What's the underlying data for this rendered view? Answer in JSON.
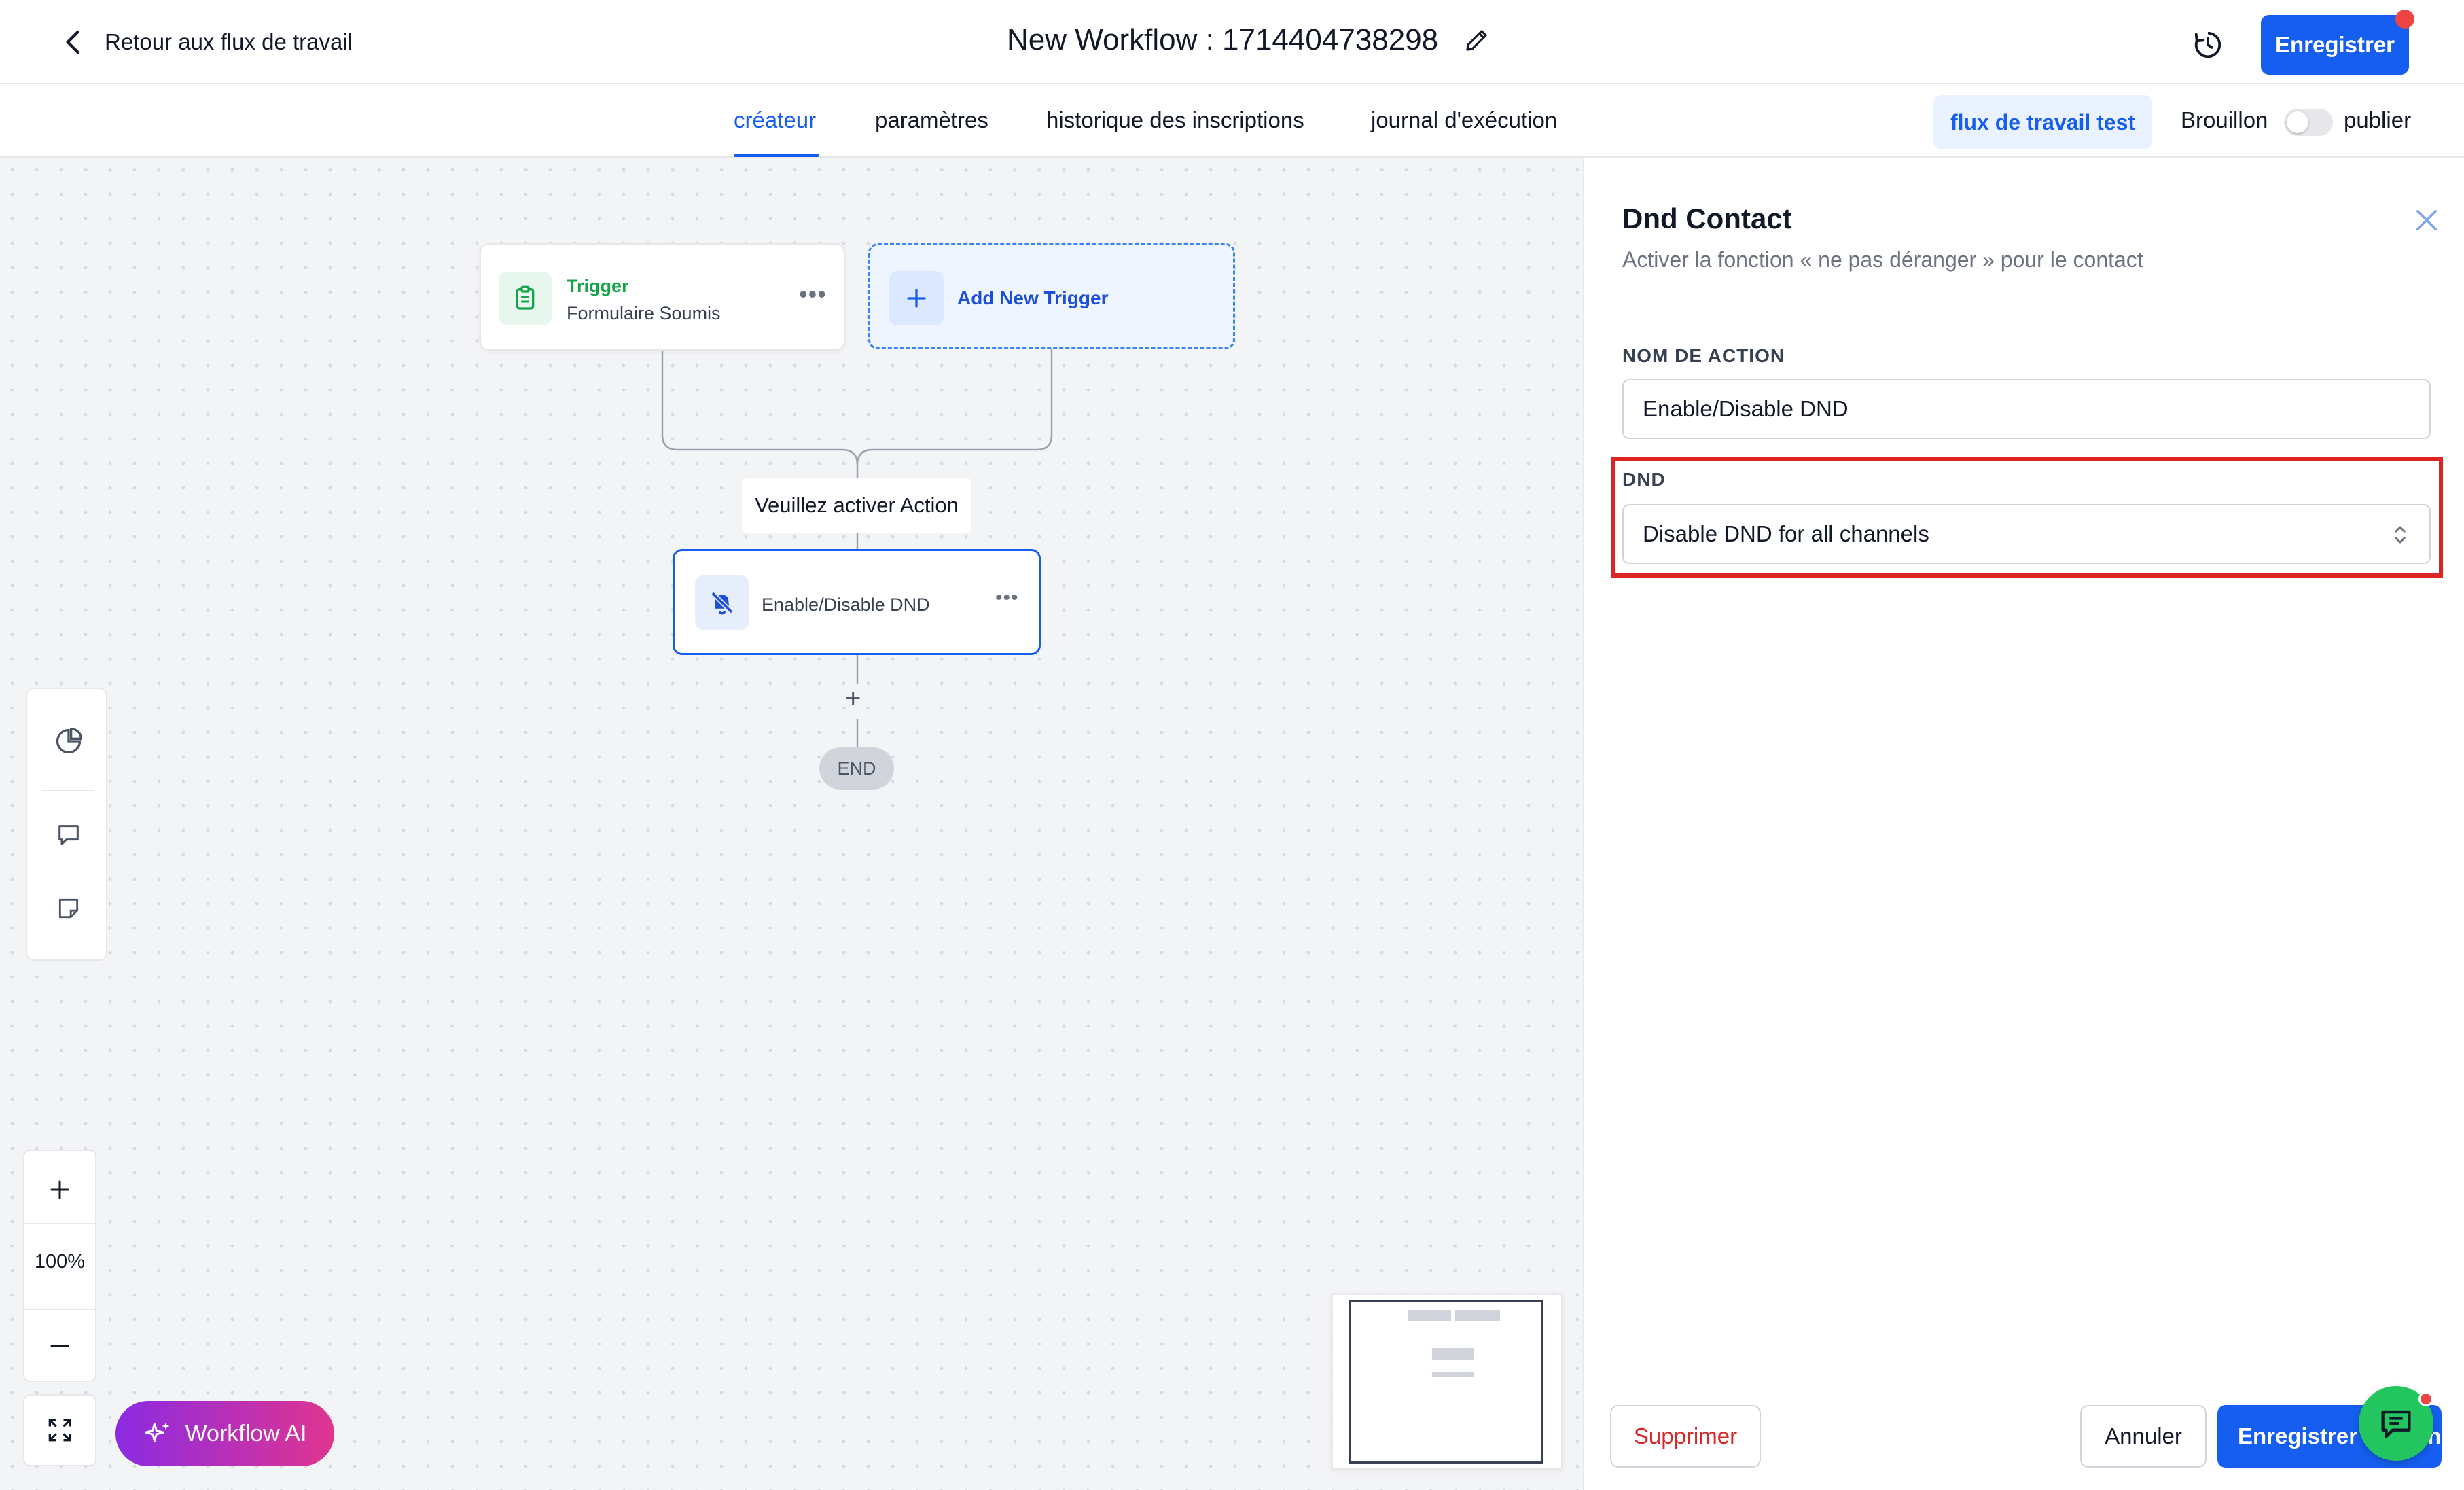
{
  "header": {
    "back_label": "Retour aux flux de travail",
    "workflow_title": "New Workflow : 1714404738298",
    "save_label": "Enregistrer"
  },
  "tabs": [
    {
      "label": "créateur",
      "active": true
    },
    {
      "label": "paramètres",
      "active": false
    },
    {
      "label": "historique des inscriptions",
      "active": false
    },
    {
      "label": "journal d'exécution",
      "active": false
    }
  ],
  "status": {
    "test_label": "flux de travail test",
    "draft_label": "Brouillon",
    "publish_label": "publier",
    "published": false
  },
  "canvas": {
    "trigger": {
      "title": "Trigger",
      "subtitle": "Formulaire Soumis"
    },
    "add_trigger_label": "Add New Trigger",
    "activate_label": "Veuillez activer Action",
    "action": {
      "label": "Enable/Disable DND"
    },
    "end_label": "END",
    "zoom": "100%",
    "ai_label": "Workflow AI"
  },
  "panel": {
    "title": "Dnd Contact",
    "subtitle": "Activer la fonction « ne pas déranger » pour le contact",
    "action_name_label": "NOM DE ACTION",
    "action_name_value": "Enable/Disable DND",
    "dnd_label": "DND",
    "dnd_value": "Disable DND for all channels",
    "delete_label": "Supprimer",
    "cancel_label": "Annuler",
    "save_label": "Enregistrer l'action"
  },
  "colors": {
    "primary": "#155eef",
    "danger": "#dc2626",
    "success": "#16a34a",
    "ai_gradient_start": "#8b2be2",
    "ai_gradient_end": "#e0358f",
    "chat": "#22c55e"
  }
}
